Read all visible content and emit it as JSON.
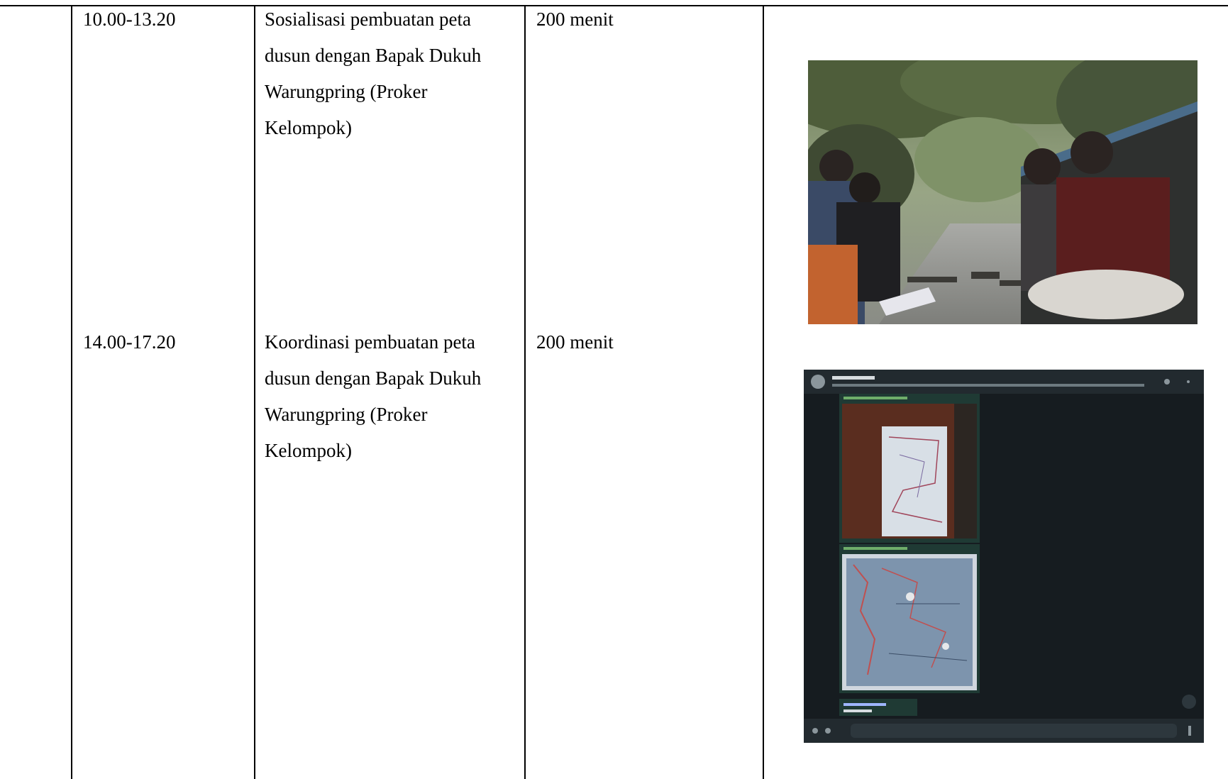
{
  "rows": [
    {
      "time": "10.00-13.20",
      "activity_lines": [
        "Sosialisasi pembuatan peta",
        "dusun dengan Bapak Dukuh",
        "Warungpring (Proker",
        "Kelompok)"
      ],
      "duration": "200 menit",
      "photo": "outdoor-meeting-photo"
    },
    {
      "time": "14.00-17.20",
      "activity_lines": [
        "Koordinasi pembuatan peta",
        "dusun dengan Bapak Dukuh",
        "Warungpring (Proker",
        "Kelompok)"
      ],
      "duration": "200 menit",
      "photo": "chat-screenshot-with-maps"
    }
  ]
}
